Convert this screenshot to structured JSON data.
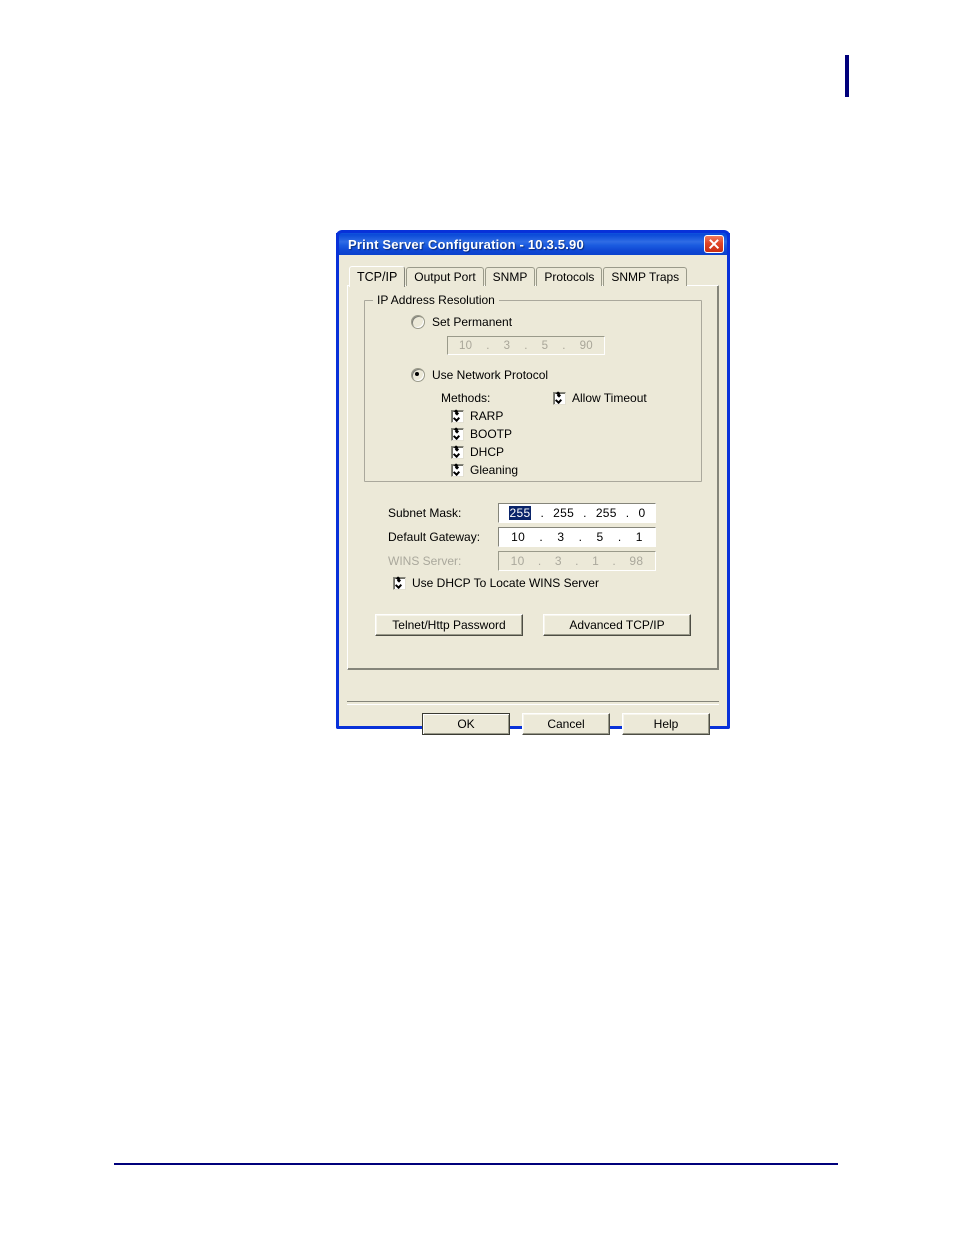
{
  "page": {
    "vertical_mark_color": "#00007b",
    "bottom_rule_color": "#00007b"
  },
  "dialog": {
    "title": "Print Server Configuration - 10.3.5.90",
    "close_icon": "close-icon",
    "tabs": [
      {
        "label": "TCP/IP",
        "active": true
      },
      {
        "label": "Output Port",
        "active": false
      },
      {
        "label": "SNMP",
        "active": false
      },
      {
        "label": "Protocols",
        "active": false
      },
      {
        "label": "SNMP Traps",
        "active": false
      }
    ],
    "group": {
      "legend": "IP Address Resolution",
      "set_permanent": {
        "label": "Set Permanent",
        "checked": false,
        "ip": {
          "o1": "10",
          "o2": "3",
          "o3": "5",
          "o4": "90",
          "dot": "."
        }
      },
      "use_network_protocol": {
        "label": "Use Network Protocol",
        "checked": true
      },
      "methods_label": "Methods:",
      "allow_timeout": {
        "label": "Allow Timeout",
        "checked": true
      },
      "methods": [
        {
          "label": "RARP",
          "checked": true
        },
        {
          "label": "BOOTP",
          "checked": true
        },
        {
          "label": "DHCP",
          "checked": true
        },
        {
          "label": "Gleaning",
          "checked": true
        }
      ]
    },
    "fields": {
      "subnet_mask": {
        "label": "Subnet Mask:",
        "disabled": false,
        "o1": "255",
        "o2": "255",
        "o3": "255",
        "o4": "0",
        "dot": ".",
        "selected_octet": 1
      },
      "default_gateway": {
        "label": "Default Gateway:",
        "disabled": false,
        "o1": "10",
        "o2": "3",
        "o3": "5",
        "o4": "1",
        "dot": "."
      },
      "wins_server": {
        "label": "WINS Server:",
        "disabled": true,
        "o1": "10",
        "o2": "3",
        "o3": "1",
        "o4": "98",
        "dot": "."
      },
      "use_dhcp_wins": {
        "label": "Use DHCP To Locate WINS Server",
        "checked": true
      }
    },
    "mid_buttons": {
      "telnet_http_password": "Telnet/Http Password",
      "advanced_tcpip": "Advanced TCP/IP"
    },
    "footer_buttons": {
      "ok": "OK",
      "cancel": "Cancel",
      "help": "Help"
    }
  }
}
